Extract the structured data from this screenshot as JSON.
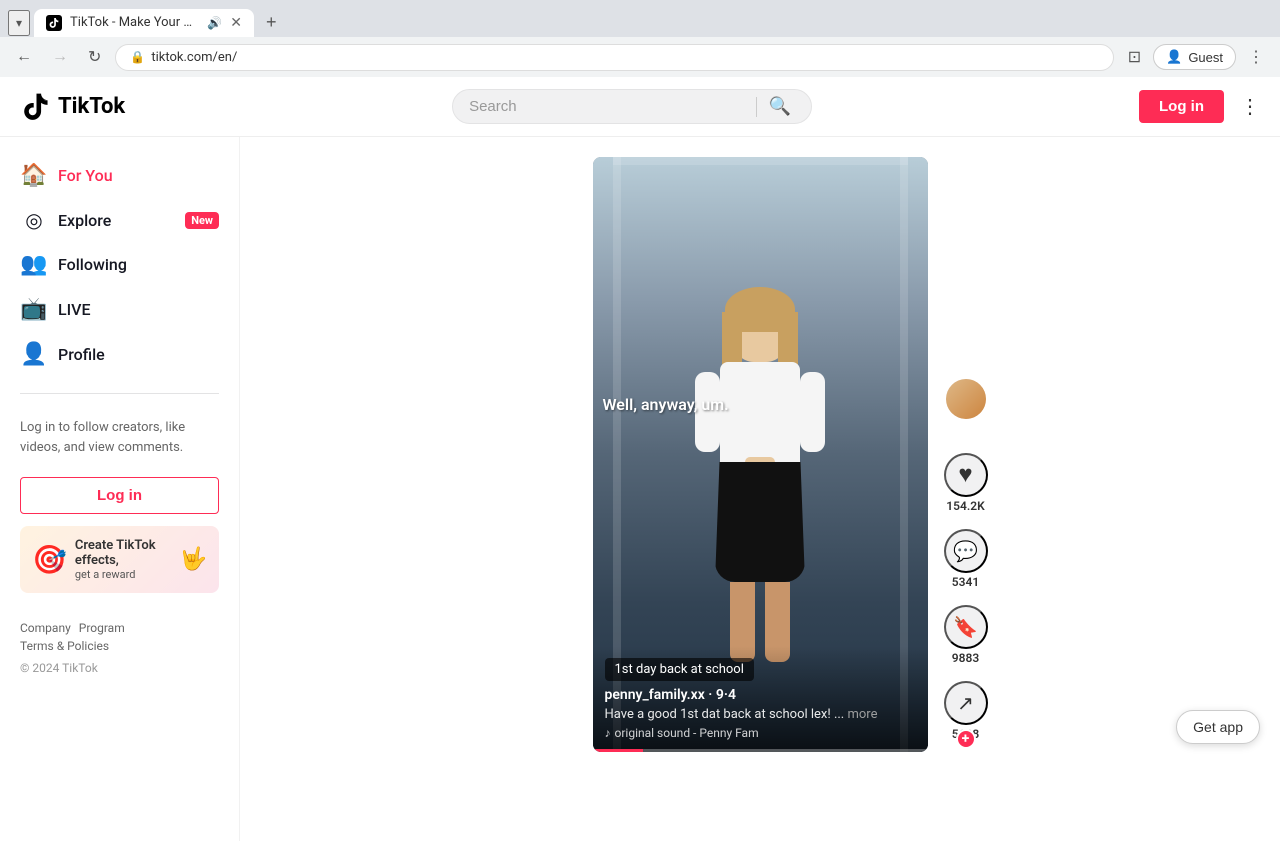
{
  "browser": {
    "tab_title": "TikTok - Make Your Day",
    "url": "tiktok.com/en/",
    "tab_list_btn": "▾",
    "new_tab_btn": "+",
    "back_disabled": false,
    "forward_disabled": true,
    "reload_label": "↻",
    "guest_label": "Guest",
    "more_btn": "⋮"
  },
  "header": {
    "logo_text": "TikTok",
    "search_placeholder": "Search",
    "login_label": "Log in",
    "more_icon": "⋮"
  },
  "sidebar": {
    "nav_items": [
      {
        "id": "for-you",
        "label": "For You",
        "icon": "🏠",
        "active": true,
        "badge": null
      },
      {
        "id": "explore",
        "label": "Explore",
        "icon": "◎",
        "active": false,
        "badge": "New"
      },
      {
        "id": "following",
        "label": "Following",
        "icon": "👥",
        "active": false,
        "badge": null
      },
      {
        "id": "live",
        "label": "LIVE",
        "icon": "📺",
        "active": false,
        "badge": null
      },
      {
        "id": "profile",
        "label": "Profile",
        "icon": "👤",
        "active": false,
        "badge": null
      }
    ],
    "promo_text": "Log in to follow creators, like videos, and view comments.",
    "login_label": "Log in",
    "create_effects": {
      "title": "Create TikTok effects,",
      "subtitle": "get a reward",
      "icon": "🎯"
    },
    "footer_links": [
      "Company",
      "Program",
      "Terms & Policies"
    ],
    "copyright": "© 2024 TikTok"
  },
  "video": {
    "username": "penny_family.xx · 9·4",
    "description": "Have a good 1st dat back at school lex! ...",
    "more_label": "more",
    "sound": "original sound - Penny Fam",
    "caption_chip": "1st day back at school",
    "text_overlay": "Well, anyway, um.",
    "likes_count": "154.2K",
    "comments_count": "5341",
    "bookmarks_count": "9883",
    "shares_count": "5698",
    "progress_pct": 15
  },
  "get_app": {
    "label": "Get app"
  },
  "icons": {
    "search": "🔍",
    "heart": "♥",
    "comment": "💬",
    "bookmark": "🔖",
    "share": "↗",
    "music_note": "♪"
  }
}
